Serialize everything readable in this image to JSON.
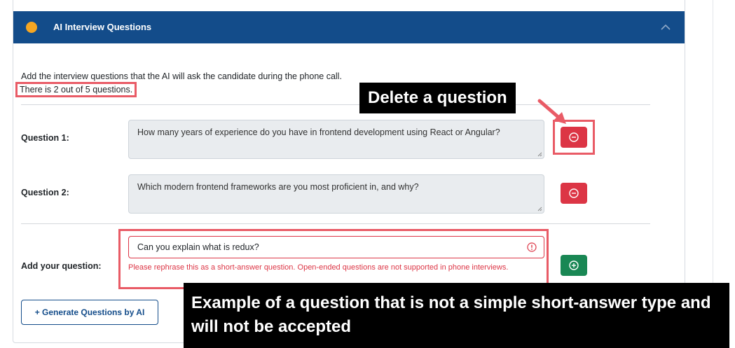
{
  "header": {
    "title": "AI Interview Questions"
  },
  "intro": {
    "text": "Add the interview questions that the AI will ask the candidate during the phone call.",
    "count_text": "There is 2 out of 5 questions."
  },
  "questions": [
    {
      "label": "Question 1:",
      "text": "How many years of experience do you have in frontend development using React or Angular?"
    },
    {
      "label": "Question 2:",
      "text": "Which modern frontend frameworks are you most proficient in, and why?"
    }
  ],
  "add_question": {
    "label": "Add your question:",
    "value": "Can you explain what is redux?",
    "error": "Please rephrase this as a short-answer question. Open-ended questions are not supported in phone interviews."
  },
  "generate_button": {
    "label": "+ Generate Questions by AI"
  },
  "annotations": {
    "delete_callout": "Delete a question",
    "example_callout": "Example of a question that is not a simple short-answer type and will not be accepted"
  },
  "colors": {
    "header_bg": "#134c8a",
    "status_dot": "#f5a623",
    "delete": "#dc3545",
    "add": "#198754",
    "highlight": "#e95b66"
  }
}
